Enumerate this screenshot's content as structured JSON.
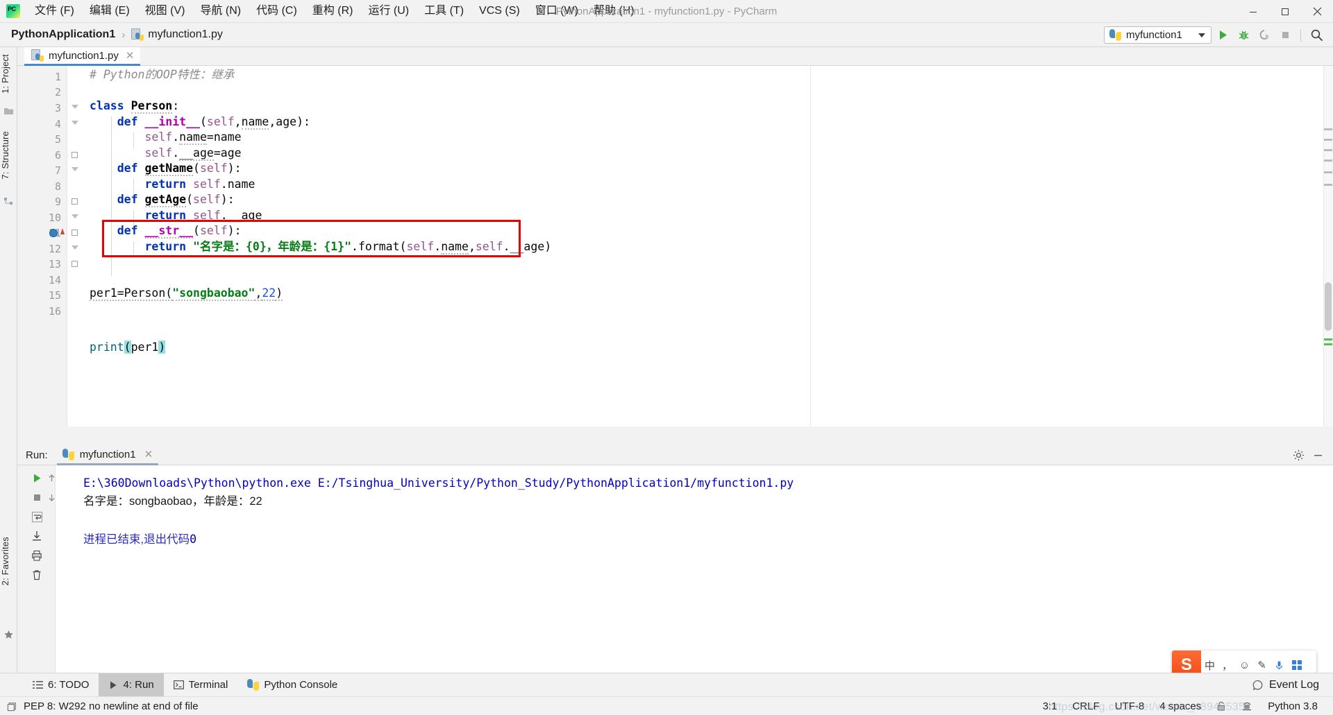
{
  "window": {
    "title": "PythonApplication1 - myfunction1.py - PyCharm",
    "app_logo": "pycharm-logo",
    "minimize": "—",
    "maximize": "❐",
    "close": "✕"
  },
  "menubar": {
    "items": [
      {
        "label": "文件 (F)",
        "name": "menu-file"
      },
      {
        "label": "编辑 (E)",
        "name": "menu-edit"
      },
      {
        "label": "视图 (V)",
        "name": "menu-view"
      },
      {
        "label": "导航 (N)",
        "name": "menu-navigate"
      },
      {
        "label": "代码 (C)",
        "name": "menu-code"
      },
      {
        "label": "重构 (R)",
        "name": "menu-refactor"
      },
      {
        "label": "运行 (U)",
        "name": "menu-run"
      },
      {
        "label": "工具 (T)",
        "name": "menu-tools"
      },
      {
        "label": "VCS (S)",
        "name": "menu-vcs"
      },
      {
        "label": "窗口 (W)",
        "name": "menu-window"
      },
      {
        "label": "帮助 (H)",
        "name": "menu-help"
      }
    ]
  },
  "navbar": {
    "breadcrumb": [
      {
        "label": "PythonApplication1",
        "icon": ""
      },
      {
        "label": "myfunction1.py",
        "icon": "python-file-icon"
      }
    ],
    "separator": "›",
    "run_config": {
      "label": "myfunction1",
      "icon": "python-icon",
      "caret": "chevron-down-icon"
    },
    "buttons": [
      {
        "name": "run-button",
        "icon": "play-icon",
        "title": "Run"
      },
      {
        "name": "debug-button",
        "icon": "bug-icon",
        "title": "Debug"
      },
      {
        "name": "run-with-coverage-button",
        "icon": "coverage-icon",
        "title": "Run with Coverage"
      },
      {
        "name": "stop-button",
        "icon": "stop-icon",
        "title": "Stop"
      },
      {
        "name": "search-everywhere-button",
        "icon": "search-icon",
        "title": "Search Everywhere"
      }
    ]
  },
  "left_tool_strip": {
    "items": [
      {
        "label": "1: Project",
        "name": "tool-window-project"
      },
      {
        "label": "7: Structure",
        "name": "tool-window-structure"
      },
      {
        "label": "2: Favorites",
        "name": "tool-window-favorites"
      }
    ]
  },
  "editor": {
    "tab": {
      "label": "myfunction1.py",
      "icon": "python-file-icon",
      "close": "✕"
    },
    "caret_position": "3:1",
    "lines": [
      {
        "n": 1,
        "text": "# Python的OOP特性：继承"
      },
      {
        "n": 2,
        "text": ""
      },
      {
        "n": 3,
        "text": "class Person:"
      },
      {
        "n": 4,
        "text": "    def __init__(self,name,age):"
      },
      {
        "n": 5,
        "text": "        self.name=name"
      },
      {
        "n": 6,
        "text": "        self.__age=age"
      },
      {
        "n": 7,
        "text": "    def getName(self):"
      },
      {
        "n": 8,
        "text": "        return self.name"
      },
      {
        "n": 9,
        "text": "    def getAge(self):"
      },
      {
        "n": 10,
        "text": "        return self.__age"
      },
      {
        "n": 11,
        "text": "    def __str__(self):"
      },
      {
        "n": 12,
        "text": "        return \"名字是：{0}，年龄是：{1}\".format(self.name,self.__age)"
      },
      {
        "n": 13,
        "text": ""
      },
      {
        "n": 14,
        "text": "per1=Person(\"songbaobao\",22)"
      },
      {
        "n": 15,
        "text": ""
      },
      {
        "n": 16,
        "text": "print(per1)"
      }
    ],
    "annotation": {
      "red_box": "highlights lines 11-12 (__str__ method)",
      "color": "#ee0000"
    }
  },
  "run_panel": {
    "label": "Run:",
    "tab": {
      "label": "myfunction1",
      "icon": "python-icon",
      "close": "✕"
    },
    "header_buttons": [
      {
        "name": "settings-gear-button",
        "icon": "gear-icon"
      },
      {
        "name": "hide-panel-button",
        "icon": "minimize-icon"
      }
    ],
    "side_buttons": [
      {
        "name": "rerun-button",
        "icon": "play-icon"
      },
      {
        "name": "stop-button",
        "icon": "stop-icon"
      },
      {
        "name": "soft-wrap-button",
        "icon": "wrap-icon"
      },
      {
        "name": "scroll-up-button",
        "icon": "arrow-up-icon"
      },
      {
        "name": "scroll-down-button",
        "icon": "arrow-down-icon"
      },
      {
        "name": "scroll-to-end-button",
        "icon": "scroll-end-icon"
      },
      {
        "name": "print-button",
        "icon": "printer-icon"
      },
      {
        "name": "clear-all-button",
        "icon": "trash-icon"
      }
    ],
    "console": {
      "command": "E:\\360Downloads\\Python\\python.exe E:/Tsinghua_University/Python_Study/PythonApplication1/myfunction1.py",
      "output": "名字是：songbaobao，年龄是：22",
      "exit_line": "进程已结束,退出代码",
      "exit_code": "0"
    }
  },
  "bottom_toolbar": {
    "items": [
      {
        "label": "6: TODO",
        "name": "tool-window-todo",
        "icon": "list-icon",
        "active": false
      },
      {
        "label": "4: Run",
        "name": "tool-window-run",
        "icon": "play-icon",
        "active": true
      },
      {
        "label": "Terminal",
        "name": "tool-window-terminal",
        "icon": "terminal-icon",
        "active": false
      },
      {
        "label": "Python Console",
        "name": "tool-window-python-console",
        "icon": "python-icon",
        "active": false
      }
    ],
    "event_log": {
      "label": "Event Log",
      "icon": "event-log-icon"
    }
  },
  "statusbar": {
    "message": "PEP 8: W292 no newline at end of file",
    "message_icon": "inspection-icon",
    "position": "3:1",
    "line_separator": "CRLF",
    "encoding": "UTF-8",
    "indent": "4 spaces",
    "lock_icon": "lock-icon",
    "inspection_icon": "hector-icon",
    "interpreter": "Python 3.8"
  },
  "ime_bar": {
    "logo": "S",
    "items": [
      {
        "label": "中",
        "name": "ime-mode-chinese"
      },
      {
        "label": "，",
        "name": "ime-punctuation"
      },
      {
        "label": "☺",
        "name": "ime-emoji"
      },
      {
        "label": "✎",
        "name": "ime-handwriting"
      },
      {
        "label": "🎤",
        "name": "ime-voice"
      },
      {
        "label": "▦",
        "name": "ime-toolbox"
      }
    ]
  },
  "watermark": "https://blog.csdn.net/weixin_48949535"
}
